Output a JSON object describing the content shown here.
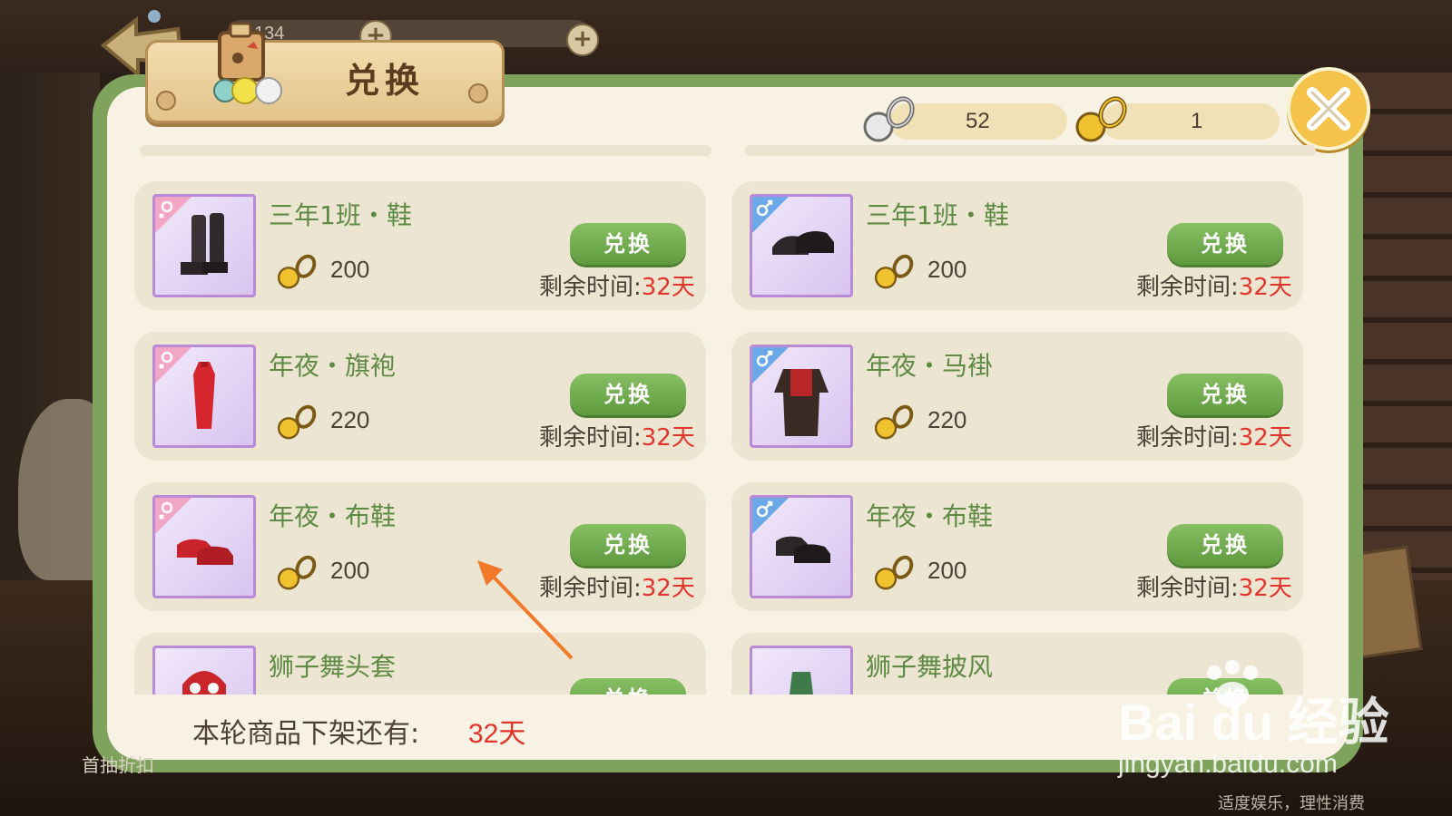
{
  "header": {
    "title": "兑换",
    "top_resource_value": "134"
  },
  "currency": {
    "silver": {
      "icon": "silver-key-icon",
      "value": "52"
    },
    "gold": {
      "icon": "gold-key-icon",
      "value": "1"
    }
  },
  "items": [
    {
      "name": "三年1班・鞋",
      "gender": "female",
      "price": "200",
      "button": "兑换",
      "remain_label": "剩余时间:",
      "remain_days": "32天"
    },
    {
      "name": "三年1班・鞋",
      "gender": "male",
      "price": "200",
      "button": "兑换",
      "remain_label": "剩余时间:",
      "remain_days": "32天"
    },
    {
      "name": "年夜・旗袍",
      "gender": "female",
      "price": "220",
      "button": "兑换",
      "remain_label": "剩余时间:",
      "remain_days": "32天"
    },
    {
      "name": "年夜・马褂",
      "gender": "male",
      "price": "220",
      "button": "兑换",
      "remain_label": "剩余时间:",
      "remain_days": "32天"
    },
    {
      "name": "年夜・布鞋",
      "gender": "female",
      "price": "200",
      "button": "兑换",
      "remain_label": "剩余时间:",
      "remain_days": "32天"
    },
    {
      "name": "年夜・布鞋",
      "gender": "male",
      "price": "200",
      "button": "兑换",
      "remain_label": "剩余时间:",
      "remain_days": "32天"
    },
    {
      "name": "狮子舞头套",
      "gender": "female",
      "price": "",
      "button": "兑换",
      "remain_label": "",
      "remain_days": ""
    },
    {
      "name": "狮子舞披风",
      "gender": "male",
      "price": "",
      "button": "兑换",
      "remain_label": "",
      "remain_days": ""
    }
  ],
  "footer": {
    "label": "本轮商品下架还有:",
    "days": "32天"
  },
  "side_label": "首抽折扣",
  "watermark": {
    "logo_text": "Bai du 经验",
    "url": "jingyan.baidu.com",
    "notice": "适度娱乐，理性消费"
  },
  "colors": {
    "panel_border": "#7fa25c",
    "panel_bg": "#f7f2e3",
    "item_name": "#5e8a43",
    "button_green": "#6fa84b",
    "days_red": "#e0352c",
    "close_yellow": "#f5c34a"
  }
}
